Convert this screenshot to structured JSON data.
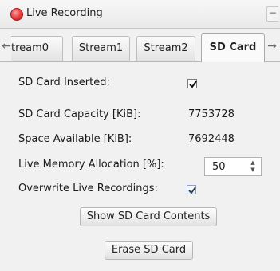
{
  "window": {
    "title": "Live Recording",
    "minimize_label": "−"
  },
  "tabs": {
    "scroll_left": "←",
    "scroll_right": "→",
    "items": [
      {
        "label": "tream0"
      },
      {
        "label": "Stream1"
      },
      {
        "label": "Stream2"
      },
      {
        "label": "SD Card",
        "active": true
      }
    ]
  },
  "sdcard": {
    "inserted_label": "SD Card Inserted:",
    "inserted_checked": true,
    "capacity_label": "SD Card Capacity [KiB]:",
    "capacity_value": "7753728",
    "available_label": "Space Available [KiB]:",
    "available_value": "7692448",
    "allocation_label": "Live Memory Allocation [%]:",
    "allocation_value": "50",
    "overwrite_label": "Overwrite Live Recordings:",
    "overwrite_checked": true,
    "show_contents_button": "Show SD Card Contents",
    "erase_button": "Erase SD Card"
  },
  "colors": {
    "record_indicator": "#e23a3a",
    "window_bg": "#f1f1f1"
  }
}
